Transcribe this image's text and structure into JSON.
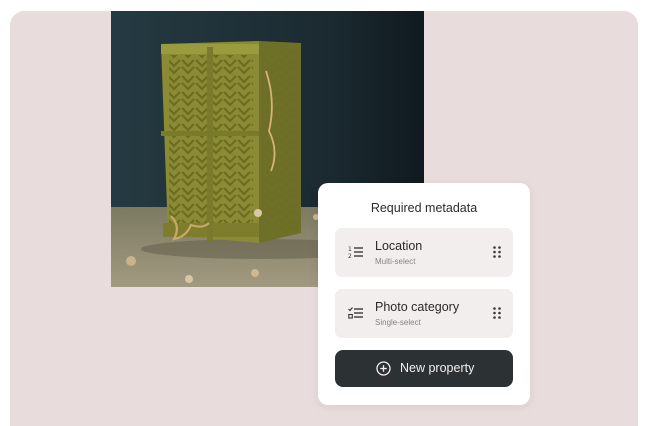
{
  "card": {
    "title": "Required metadata",
    "properties": [
      {
        "name": "Location",
        "type": "Multi-select",
        "icon": "numbered-list-icon"
      },
      {
        "name": "Photo category",
        "type": "Single-select",
        "icon": "checklist-icon"
      }
    ],
    "new_property_label": "New property",
    "new_property_icon": "plus-circle-icon"
  },
  "colors": {
    "background": "#e8dddc",
    "card": "#ffffff",
    "property_row": "#f3eeee",
    "button": "#2c3133",
    "crate": "#8a8a34"
  }
}
